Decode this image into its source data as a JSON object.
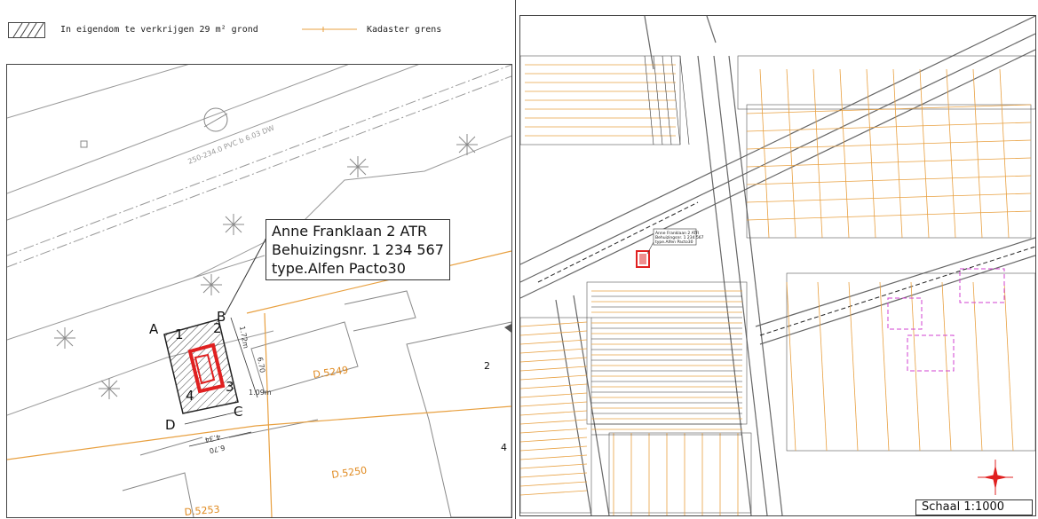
{
  "legend": {
    "hatch_label": "In eigendom te verkrijgen 29 m² grond",
    "kadaster_label": "Kadaster grens",
    "kadaster_color": "#e8a040"
  },
  "label": {
    "line1": "Anne Franklaan 2 ATR",
    "line2": "Behuizingsnr. 1 234 567",
    "line3": "type.Alfen Pacto30"
  },
  "points": {
    "a": "A",
    "b": "B",
    "c": "C",
    "d": "D",
    "n1": "1",
    "n2": "2",
    "n3": "3",
    "n4": "4"
  },
  "parcels": {
    "p5249": "D.5249",
    "p5250": "D.5250",
    "p5253": "D.5253"
  },
  "house_numbers": {
    "h2": "2",
    "h4": "4"
  },
  "dims": {
    "d1": "1.09m",
    "d2": "6.70",
    "d3": "1.72m",
    "d4": "4.34",
    "d5": "6.70"
  },
  "road_label": "250-234.0 PVC b 6.03 DW",
  "overview_label": {
    "line1": "Anne Franklaan 2 ATR",
    "line2": "Behuizingsnr. 1 234 567",
    "line3": "type.Alfen Pacto30"
  },
  "scale": "Schaal 1:1000",
  "colors": {
    "kadaster": "#e8a040",
    "station": "#e02020",
    "sewer": "#d040d0"
  }
}
